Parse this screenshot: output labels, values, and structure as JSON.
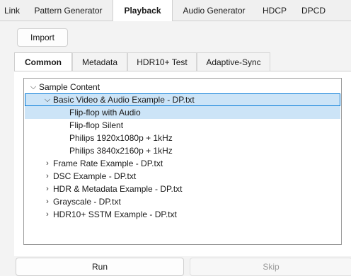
{
  "top_tabs": [
    "Link",
    "Pattern Generator",
    "Playback",
    "Audio Generator",
    "HDCP",
    "DPCD"
  ],
  "import_label": "Import",
  "inner_tabs": [
    "Common",
    "Metadata",
    "HDR10+ Test",
    "Adaptive-Sync"
  ],
  "tree": {
    "root": "Sample Content",
    "basic_file": "Basic Video & Audio Example - DP.txt",
    "basic_children": [
      "Flip-flop with Audio",
      "Flip-flop Silent",
      "Philips 1920x1080p + 1kHz",
      "Philips 3840x2160p + 1kHz"
    ],
    "other_files": [
      "Frame Rate Example - DP.txt",
      "DSC Example - DP.txt",
      "HDR & Metadata Example - DP.txt",
      "Grayscale - DP.txt",
      "HDR10+ SSTM Example - DP.txt"
    ]
  },
  "run_label": "Run",
  "skip_label": "Skip",
  "colors": {
    "selection": "#cce4f7",
    "focus_border": "#0078d7"
  },
  "icons": {
    "expanded": "chevron-down-icon",
    "collapsed": "chevron-right-icon"
  }
}
